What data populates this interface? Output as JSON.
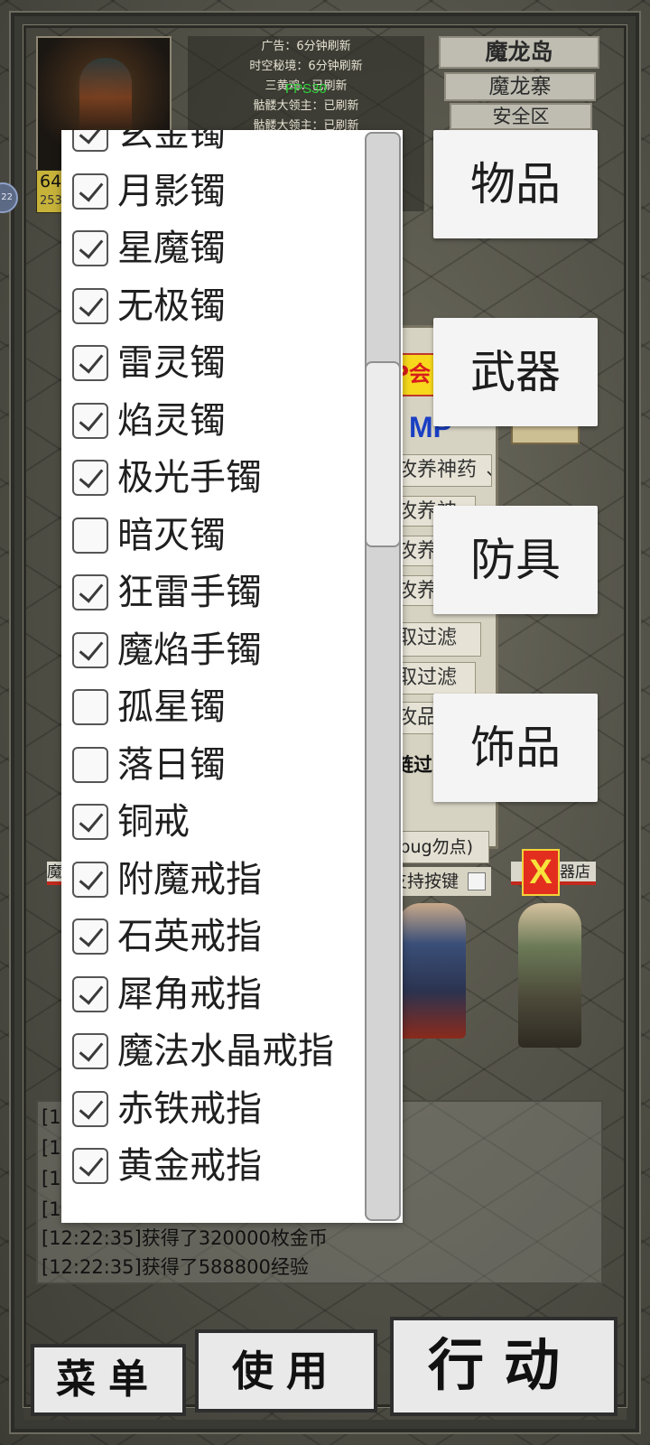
{
  "hud": {
    "level_partial": "64",
    "level_sub_partial": "253",
    "side_circle_text": "22",
    "fps": "FPS30",
    "notices": [
      "广告：6分钟刷新",
      "时空秘境：6分钟刷新",
      "三黄鸡：已刷新",
      "骷髅大领主：已刷新",
      "骷髅大领主：已刷新"
    ],
    "locations": {
      "island": "魔龙岛",
      "fort": "魔龙寨",
      "safe_zone": "安全区"
    }
  },
  "game_panel": {
    "vip_partial": "P会",
    "mp_label": "MP",
    "potion_select": "攻养神药 ⌄",
    "potion_rows": [
      "攻养神",
      "攻养神",
      "攻养神"
    ],
    "filter_button_1": "取过滤",
    "filter_button_2": "取过滤",
    "obscured_button": "攻品",
    "chain_text": "链过",
    "bug_button": "(bug勿点)",
    "key_support_label": "支持按键",
    "npc_left_label": "魔",
    "npc_right_label": "器店",
    "close_symbol": "X"
  },
  "categories": {
    "items": "物品",
    "weapons": "武器",
    "armor": "防具",
    "jewelry": "饰品"
  },
  "filter_list": [
    {
      "label": "玄金镯",
      "checked": true
    },
    {
      "label": "月影镯",
      "checked": true
    },
    {
      "label": "星魔镯",
      "checked": true
    },
    {
      "label": "无极镯",
      "checked": true
    },
    {
      "label": "雷灵镯",
      "checked": true
    },
    {
      "label": "焰灵镯",
      "checked": true
    },
    {
      "label": "极光手镯",
      "checked": true
    },
    {
      "label": "暗灭镯",
      "checked": false
    },
    {
      "label": "狂雷手镯",
      "checked": true
    },
    {
      "label": "魔焰手镯",
      "checked": true
    },
    {
      "label": "孤星镯",
      "checked": false
    },
    {
      "label": "落日镯",
      "checked": false
    },
    {
      "label": "铜戒",
      "checked": true
    },
    {
      "label": "附魔戒指",
      "checked": true
    },
    {
      "label": "石英戒指",
      "checked": true
    },
    {
      "label": "犀角戒指",
      "checked": true
    },
    {
      "label": "魔法水晶戒指",
      "checked": true
    },
    {
      "label": "赤铁戒指",
      "checked": true
    },
    {
      "label": "黄金戒指",
      "checked": true
    }
  ],
  "chat": {
    "partial_prefix": "[12",
    "lines": [
      "[12:22:35]获得了320000枚金币",
      "[12:22:35]获得了588800经验"
    ]
  },
  "bottom_bar": {
    "menu": "菜单",
    "use": "使用",
    "action": "行动"
  }
}
